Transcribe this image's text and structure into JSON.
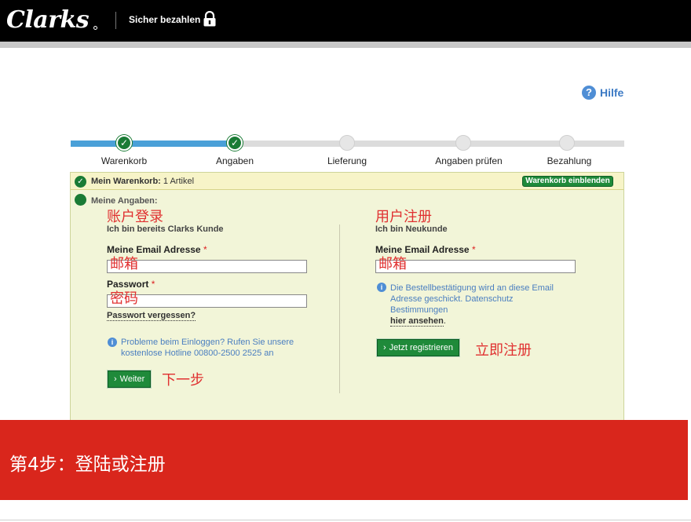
{
  "header": {
    "brand": "Clarks",
    "secure_label": "Sicher bezahlen",
    "lock_icon": "lock-icon"
  },
  "help": {
    "label": "Hilfe",
    "icon": "question-mark-icon",
    "icon_glyph": "?"
  },
  "progress": {
    "steps": [
      {
        "label": "Warenkorb",
        "done": true
      },
      {
        "label": "Angaben",
        "done": true
      },
      {
        "label": "Lieferung",
        "done": false
      },
      {
        "label": "Angaben prüfen",
        "done": false
      },
      {
        "label": "Bezahlung",
        "done": false
      }
    ],
    "check_glyph": "✓"
  },
  "cart": {
    "label": "Mein Warenkorb:",
    "count": "1 Artikel",
    "button": "Warenkorb einblenden"
  },
  "details": {
    "title": "Meine Angaben:"
  },
  "login": {
    "annotation": "账户登录",
    "heading": "Ich bin bereits Clarks Kunde",
    "email_label": "Meine Email Adresse",
    "email_annotation": "邮箱",
    "password_label": "Passwort",
    "password_annotation": "密码",
    "required_mark": "*",
    "forgot_link": "Passwort vergessen?",
    "info_line1": "Probleme beim Einloggen? Rufen Sie unsere",
    "info_line2": "kostenlose Hotline 00800-2500 2525 an",
    "button": "Weiter",
    "button_annotation": "下一步"
  },
  "register": {
    "annotation": "用户注册",
    "heading": "Ich bin Neukunde",
    "email_label": "Meine Email Adresse",
    "email_annotation": "邮箱",
    "required_mark": "*",
    "info_line1": "Die Bestellbestätigung wird an diese Email",
    "info_line2": "Adresse geschickt. Datenschutz",
    "info_line3": "Bestimmungen",
    "info_link": "hier ansehen",
    "info_link_suffix": ".",
    "button": "Jetzt registrieren",
    "button_annotation": "立即注册"
  },
  "banner": {
    "text": "第4步：登陆或注册"
  },
  "colors": {
    "brand_black": "#000000",
    "accent_green": "#1f8a3a",
    "progress_blue": "#4aa0d8",
    "banner_red": "#d9261c",
    "annotation_red": "#e03030"
  }
}
